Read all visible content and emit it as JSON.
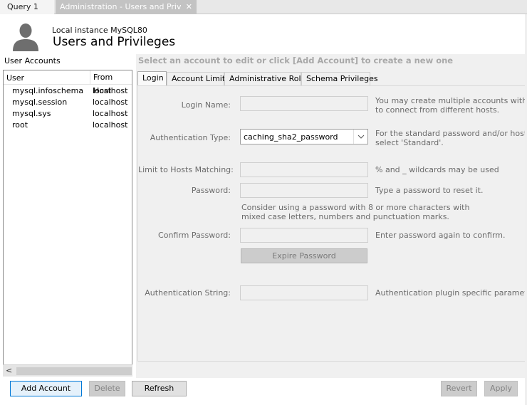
{
  "tabs": [
    {
      "label": "Query 1"
    },
    {
      "label": "Administration - Users and Privil..."
    }
  ],
  "header": {
    "instance": "Local instance MySQL80",
    "title": "Users and Privileges"
  },
  "accounts": {
    "label": "User Accounts",
    "columns": {
      "user": "User",
      "host": "From Host"
    },
    "rows": [
      {
        "user": "mysql.infoschema",
        "host": "localhost"
      },
      {
        "user": "mysql.session",
        "host": "localhost"
      },
      {
        "user": "mysql.sys",
        "host": "localhost"
      },
      {
        "user": "root",
        "host": "localhost"
      }
    ]
  },
  "hint": "Select an account to edit or click [Add Account] to create a new one",
  "subtabs": [
    "Login",
    "Account Limits",
    "Administrative Roles",
    "Schema Privileges"
  ],
  "form": {
    "login_name": {
      "label": "Login Name:",
      "value": "",
      "help": "You may create multiple accounts with the same name",
      "help2": "to connect from different hosts."
    },
    "auth_type": {
      "label": "Authentication Type:",
      "value": "caching_sha2_password",
      "help": "For the standard password and/or host based authentication,",
      "help2": "select 'Standard'."
    },
    "hosts": {
      "label": "Limit to Hosts Matching:",
      "value": "",
      "help": "% and _ wildcards may be used"
    },
    "password": {
      "label": "Password:",
      "value": "",
      "help": "Type a password to reset it.",
      "note1": "Consider using a password with 8 or more characters with",
      "note2": "mixed case letters, numbers and punctuation marks."
    },
    "confirm": {
      "label": "Confirm Password:",
      "value": "",
      "help": "Enter password again to confirm."
    },
    "expire_button": "Expire Password",
    "auth_string": {
      "label": "Authentication String:",
      "value": "",
      "help": "Authentication plugin specific parameters."
    }
  },
  "buttons": {
    "add": "Add Account",
    "delete": "Delete",
    "refresh": "Refresh",
    "revert": "Revert",
    "apply": "Apply"
  },
  "icons": {
    "user": "user-silhouette-icon",
    "close": "close-icon",
    "dropdown": "chevron-down-icon",
    "scroll_left": "arrow-left-icon"
  },
  "colors": {
    "accent": "#0078d7",
    "active_doc_tab": "#c3c3c3",
    "disabled_text": "#838383"
  }
}
